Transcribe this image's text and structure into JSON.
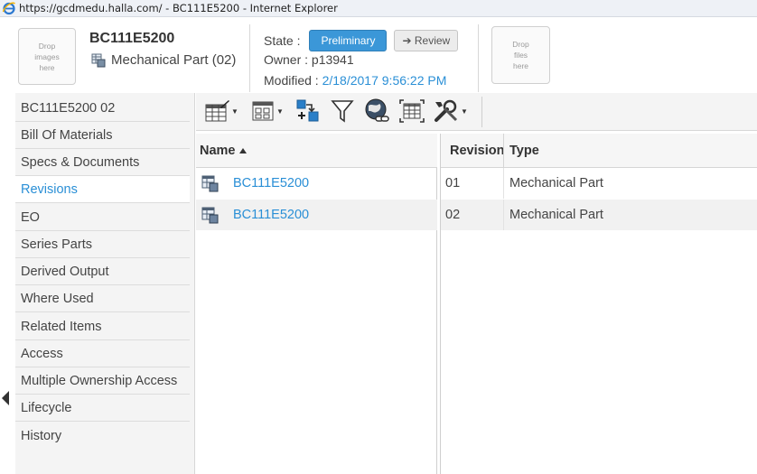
{
  "window": {
    "url_title": "https://gcdmedu.halla.com/ - BC111E5200 - Internet Explorer"
  },
  "header": {
    "drop_images_text": "Drop\nimages\nhere",
    "drop_files_text": "Drop\nfiles\nhere",
    "title": "BC111E5200",
    "object_type": "Mechanical Part (02)",
    "state_label": "State :",
    "state_value": "Preliminary",
    "review_label": "Review",
    "owner_text": "Owner : p13941",
    "modified_label": "Modified :",
    "modified_value": "2/18/2017 9:56:22 PM"
  },
  "nav": {
    "items": [
      {
        "label": "BC111E5200 02",
        "active": false
      },
      {
        "label": "Bill Of Materials",
        "active": false
      },
      {
        "label": "Specs & Documents",
        "active": false
      },
      {
        "label": "Revisions",
        "active": true
      },
      {
        "label": "EO",
        "active": false
      },
      {
        "label": "Series Parts",
        "active": false
      },
      {
        "label": "Derived Output",
        "active": false
      },
      {
        "label": "Where Used",
        "active": false
      },
      {
        "label": "Related Items",
        "active": false
      },
      {
        "label": "Access",
        "active": false
      },
      {
        "label": "Multiple Ownership Access",
        "active": false
      },
      {
        "label": "Lifecycle",
        "active": false
      },
      {
        "label": "History",
        "active": false
      }
    ]
  },
  "toolbar": {
    "icons": [
      "edit-table-icon",
      "view-mode-icon",
      "add-existing-icon",
      "filter-icon",
      "globe-link-icon",
      "select-all-icon",
      "tools-icon"
    ]
  },
  "grid": {
    "columns": {
      "name": "Name",
      "revision": "Revision",
      "type": "Type"
    },
    "rows": [
      {
        "name": "BC111E5200",
        "revision": "01",
        "type": "Mechanical Part"
      },
      {
        "name": "BC111E5200",
        "revision": "02",
        "type": "Mechanical Part"
      }
    ]
  },
  "colors": {
    "link": "#2a8fd6",
    "primary_button": "#3b97d8"
  }
}
